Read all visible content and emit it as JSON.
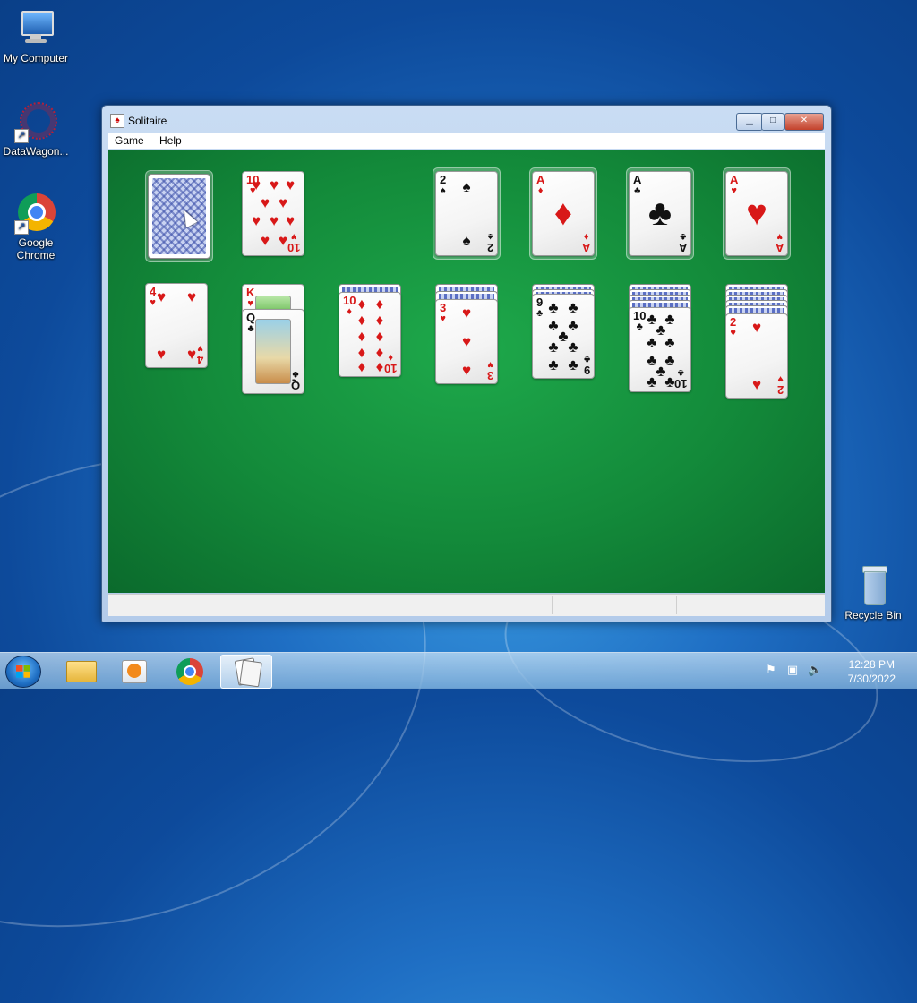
{
  "desktop": {
    "icons": [
      {
        "label": "My Computer"
      },
      {
        "label": "DataWagon..."
      },
      {
        "label": "Google Chrome"
      },
      {
        "label": "Recycle Bin"
      }
    ]
  },
  "window": {
    "title": "Solitaire",
    "buttons": {
      "minimize": "▁",
      "maximize": "□",
      "close": "✕"
    },
    "menu": {
      "game": "Game",
      "help": "Help"
    }
  },
  "game": {
    "stock": "face-down deck",
    "waste": {
      "rank": "10",
      "suit": "♥"
    },
    "foundations": [
      {
        "rank": "2",
        "suit": "♠",
        "color": "black"
      },
      {
        "rank": "A",
        "suit": "♦",
        "color": "red"
      },
      {
        "rank": "A",
        "suit": "♣",
        "color": "black"
      },
      {
        "rank": "A",
        "suit": "♥",
        "color": "red"
      }
    ],
    "tableau": [
      {
        "hidden": 0,
        "top": {
          "rank": "4",
          "suit": "♥",
          "color": "red"
        }
      },
      {
        "hidden": 0,
        "under": {
          "rank": "K",
          "suit": "♥",
          "color": "red"
        },
        "top": {
          "rank": "Q",
          "suit": "♣",
          "color": "black"
        }
      },
      {
        "hidden": 1,
        "top": {
          "rank": "10",
          "suit": "♦",
          "color": "red"
        }
      },
      {
        "hidden": 2,
        "top": {
          "rank": "3",
          "suit": "♥",
          "color": "red"
        }
      },
      {
        "hidden": 3,
        "top": {
          "rank": "9",
          "suit": "♣",
          "color": "black"
        }
      },
      {
        "hidden": 4,
        "top": {
          "rank": "10",
          "suit": "♣",
          "color": "black"
        }
      },
      {
        "hidden": 5,
        "top": {
          "rank": "2",
          "suit": "♥",
          "color": "red"
        }
      }
    ]
  },
  "taskbar": {
    "items": [
      "windows-explorer",
      "media-player",
      "google-chrome",
      "solitaire"
    ],
    "clock": {
      "time": "12:28 PM",
      "date": "7/30/2022"
    }
  },
  "colors": {
    "felt": "#138a3a",
    "red_suit": "#d81818",
    "desktop": "#1f6fc4"
  }
}
